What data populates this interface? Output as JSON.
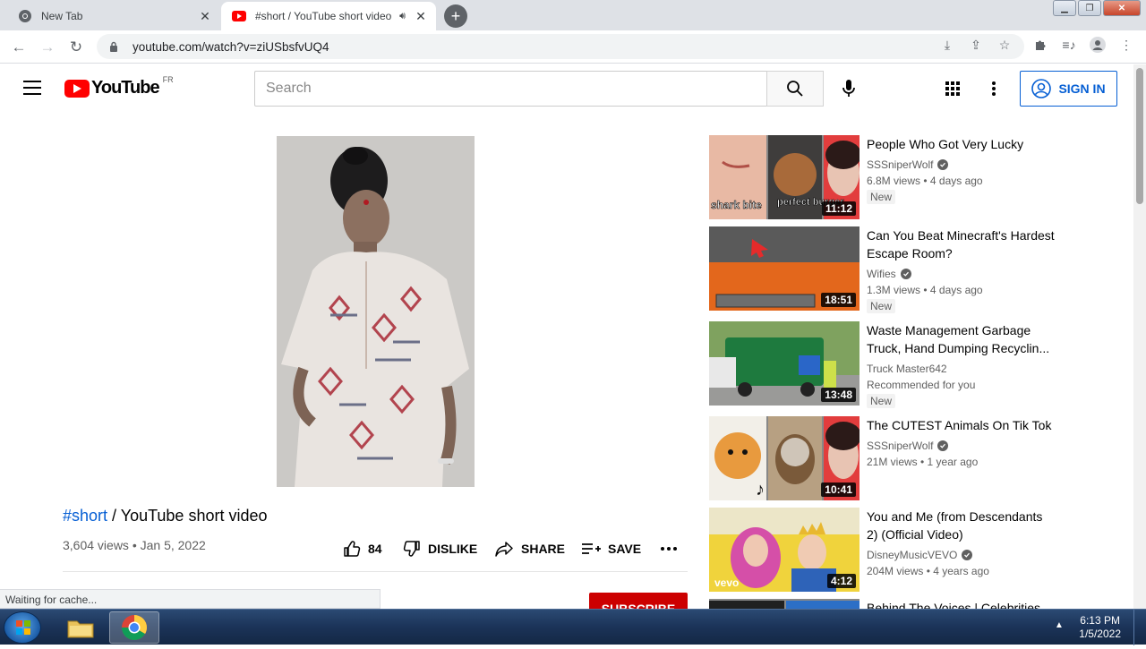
{
  "browser": {
    "tabs": [
      {
        "title": "New Tab",
        "active": false
      },
      {
        "title": "#short / YouTube short video",
        "active": true
      }
    ],
    "url": "youtube.com/watch?v=ziUSbsfvUQ4",
    "status": "Waiting for cache..."
  },
  "header": {
    "logo_text": "YouTube",
    "region": "FR",
    "search_placeholder": "Search",
    "signin_label": "SIGN IN"
  },
  "video": {
    "hashtag": "#short",
    "title_rest": " / YouTube short video",
    "meta": "3,604 views • Jan 5, 2022",
    "likes": "84",
    "dislike_label": "DISLIKE",
    "share_label": "SHARE",
    "save_label": "SAVE",
    "subscribe_label": "SUBSCRIBE"
  },
  "recommendations": [
    {
      "title": "People Who Got Very Lucky",
      "channel": "SSSniperWolf",
      "verified": true,
      "stats": "6.8M views • 4 days ago",
      "badge": "New",
      "duration": "11:12",
      "thumb_text_1": "shark bite",
      "thumb_text_2": "perfect burger"
    },
    {
      "title": "Can You Beat Minecraft's Hardest Escape Room?",
      "channel": "Wifies",
      "verified": true,
      "stats": "1.3M views • 4 days ago",
      "badge": "New",
      "duration": "18:51"
    },
    {
      "title": "Waste Management Garbage Truck, Hand Dumping Recyclin...",
      "channel": "Truck Master642",
      "verified": false,
      "stats": "Recommended for you",
      "badge": "New",
      "duration": "13:48"
    },
    {
      "title": "The CUTEST Animals On Tik Tok",
      "channel": "SSSniperWolf",
      "verified": true,
      "stats": "21M views • 1 year ago",
      "badge": "",
      "duration": "10:41"
    },
    {
      "title": "You and Me (from Descendants 2) (Official Video)",
      "channel": "DisneyMusicVEVO",
      "verified": true,
      "stats": "204M views • 4 years ago",
      "badge": "",
      "duration": "4:12",
      "thumb_text_1": "vevo"
    },
    {
      "title": "Behind The Voices | Celebrities",
      "channel": "",
      "verified": false,
      "stats": "",
      "badge": "",
      "duration": ""
    }
  ],
  "taskbar": {
    "time": "6:13 PM",
    "date": "1/5/2022"
  },
  "colors": {
    "brand_red": "#ff0000",
    "link_blue": "#065fd4",
    "subscribe_red": "#cc0000"
  }
}
